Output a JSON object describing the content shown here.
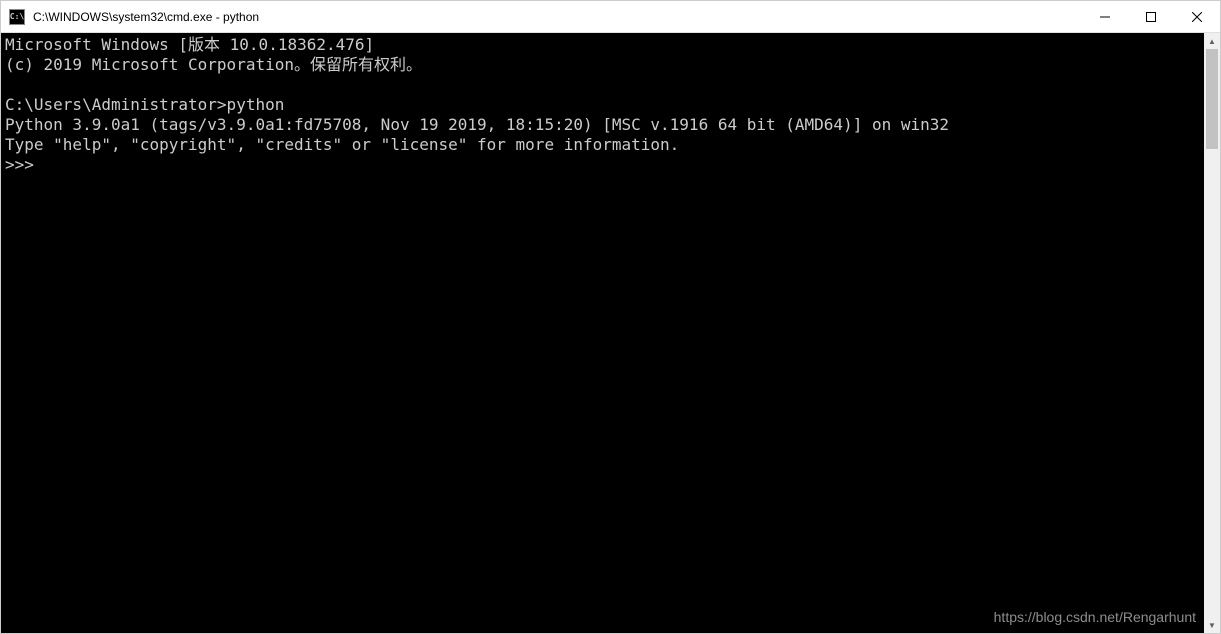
{
  "window": {
    "icon_text": "C:\\",
    "title": "C:\\WINDOWS\\system32\\cmd.exe - python"
  },
  "console": {
    "line1": "Microsoft Windows [版本 10.0.18362.476]",
    "line2": "(c) 2019 Microsoft Corporation。保留所有权利。",
    "line3": "",
    "line4": "C:\\Users\\Administrator>python",
    "line5": "Python 3.9.0a1 (tags/v3.9.0a1:fd75708, Nov 19 2019, 18:15:20) [MSC v.1916 64 bit (AMD64)] on win32",
    "line6": "Type \"help\", \"copyright\", \"credits\" or \"license\" for more information.",
    "line7": ">>> "
  },
  "watermark": "https://blog.csdn.net/Rengarhunt"
}
